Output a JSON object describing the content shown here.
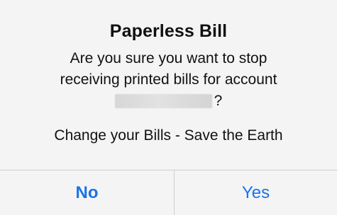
{
  "dialog": {
    "title": "Paperless Bill",
    "message_line1": "Are you sure you want to stop",
    "message_line2": "receiving printed bills for account",
    "message_line3_suffix": "?",
    "tagline": "Change your Bills - Save the Earth",
    "buttons": {
      "no_label": "No",
      "yes_label": "Yes"
    }
  },
  "colors": {
    "background": "#f4f4f5",
    "accent": "#1a73e8",
    "divider": "#cfcfd3",
    "text": "#111111"
  }
}
